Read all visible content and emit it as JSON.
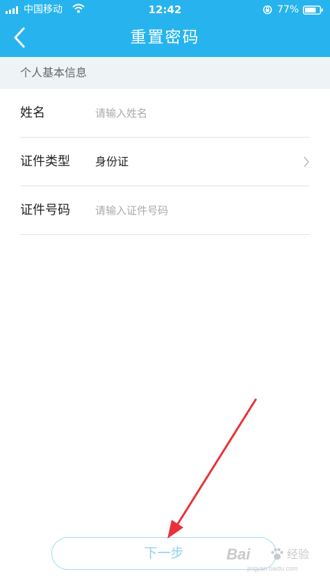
{
  "status_bar": {
    "carrier": "中国移动",
    "time": "12:42",
    "battery": "77%",
    "battery_level": 0.77,
    "icons": [
      "signal-icon",
      "wifi-icon",
      "rotation-lock-icon",
      "battery-icon"
    ]
  },
  "nav": {
    "title": "重置密码",
    "back_icon": "chevron-left-icon"
  },
  "section": {
    "title": "个人基本信息"
  },
  "form": {
    "name_label": "姓名",
    "name_placeholder": "请输入姓名",
    "id_type_label": "证件类型",
    "id_type_value": "身份证",
    "id_number_label": "证件号码",
    "id_number_placeholder": "请输入证件号码"
  },
  "next_button": {
    "label": "下一步"
  },
  "watermark": {
    "logo": "Bai",
    "sub": "经验",
    "url": "jingyan.baidu.com"
  },
  "colors": {
    "accent": "#27b4ee",
    "section_bg": "#eef3f6",
    "divider": "#e2e2e2",
    "placeholder": "#aaaaaa",
    "button_border": "#9fdcf2",
    "button_text": "#8fd2ee",
    "annotation_arrow": "#e8323a"
  }
}
